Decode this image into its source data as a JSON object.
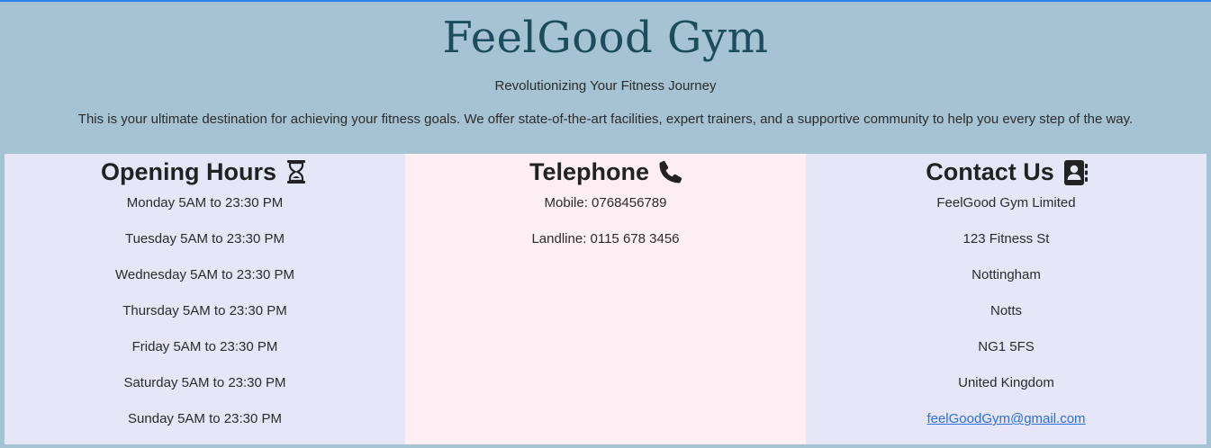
{
  "header": {
    "brand": "FeelGood Gym",
    "tagline": "Revolutionizing Your Fitness Journey",
    "intro": "This is your ultimate destination for achieving your fitness goals. We offer state-of-the-art facilities, expert trainers, and a supportive community to help you every step of the way."
  },
  "hours": {
    "title": "Opening Hours",
    "icon": "hourglass-icon",
    "items": [
      "Monday 5AM to 23:30 PM",
      "Tuesday 5AM to 23:30 PM",
      "Wednesday 5AM to 23:30 PM",
      "Thursday 5AM to 23:30 PM",
      "Friday 5AM to 23:30 PM",
      "Saturday 5AM to 23:30 PM",
      "Sunday 5AM to 23:30 PM"
    ]
  },
  "phone": {
    "title": "Telephone",
    "icon": "telephone-icon",
    "items": [
      "Mobile: 0768456789",
      "Landline: 0115 678 3456"
    ]
  },
  "contact": {
    "title": "Contact Us",
    "icon": "contact-book-icon",
    "items": [
      "FeelGood Gym Limited",
      "123 Fitness St",
      "Nottingham",
      "Notts",
      "NG1 5FS",
      "United Kingdom"
    ],
    "email": "feelGoodGym@gmail.com"
  },
  "colors": {
    "background": "#a6c3d4",
    "brand": "#1b4d5c",
    "column_lavender": "#e5e6f8",
    "column_pink": "#fdeff3",
    "link": "#2f6fd6",
    "top_border": "#2f86f6"
  }
}
